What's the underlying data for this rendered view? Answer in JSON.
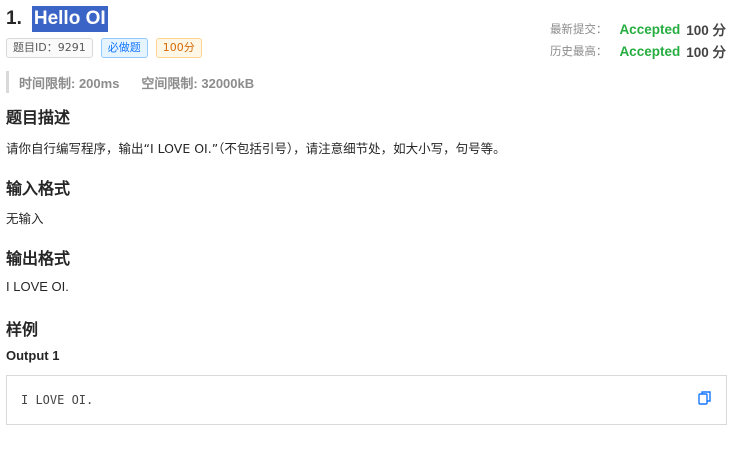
{
  "problem": {
    "number": "1.",
    "title": "Hello OI",
    "tags": [
      "题目ID：9291",
      "必做题",
      "100分"
    ]
  },
  "stats": {
    "latest_label": "最新提交：",
    "latest_status": "Accepted",
    "latest_score": "100 分",
    "best_label": "历史最高：",
    "best_status": "Accepted",
    "best_score": "100 分"
  },
  "limits": {
    "time": "时间限制: 200ms",
    "memory": "空间限制: 32000kB"
  },
  "sections": {
    "description_title": "题目描述",
    "description_text": "请你自行编写程序，输出“I LOVE OI.”（不包括引号），请注意细节处，如大小写，句号等。",
    "input_title": "输入格式",
    "input_text": "无输入",
    "output_title": "输出格式",
    "output_text": "I LOVE OI.",
    "sample_title": "样例"
  },
  "sample": {
    "output_heading": "Output 1",
    "output_code": "I LOVE OI.",
    "copy_icon": "copy-icon"
  },
  "colors": {
    "accepted": "#25ad40",
    "title_highlight": "#3b64c7",
    "copy_icon": "#1677ff"
  }
}
